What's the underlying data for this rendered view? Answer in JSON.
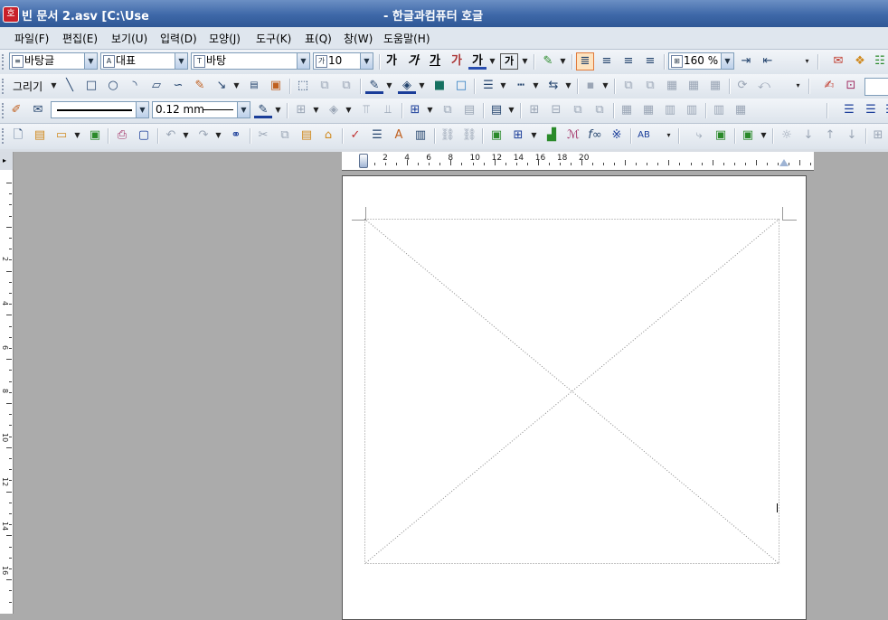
{
  "window": {
    "title_left": "빈 문서 2.asv [C:\\Users",
    "title_right": "- 한글과컴퓨터 호글",
    "app_icon": "호"
  },
  "menu": [
    "파일(F)",
    "편집(E)",
    "보기(U)",
    "입력(D)",
    "모양(J)",
    "도구(K)",
    "표(Q)",
    "창(W)",
    "도움말(H)"
  ],
  "format_toolbar": {
    "style": "바탕글",
    "style_icon": "style-icon",
    "language": "대표",
    "font": "바탕",
    "font_size": "10",
    "zoom": "160 %",
    "bold": "가",
    "italic": "가",
    "underline": "가",
    "strike": "가",
    "color": "가",
    "outline": "가"
  },
  "drawing_toolbar": {
    "label": "그리기"
  },
  "line_toolbar": {
    "line_width": "0.12 mm"
  },
  "ruler": {
    "top_numbers": [
      "2",
      "4",
      "6",
      "8",
      "10",
      "12",
      "14",
      "16",
      "18",
      "20"
    ],
    "left_numbers": [
      "2",
      "4",
      "6",
      "8",
      "10",
      "12",
      "14",
      "16"
    ]
  },
  "colors": {
    "titlebar": "#3e68a8",
    "workspace": "#ababab",
    "page": "#ffffff",
    "accent": "#e07a3c"
  }
}
